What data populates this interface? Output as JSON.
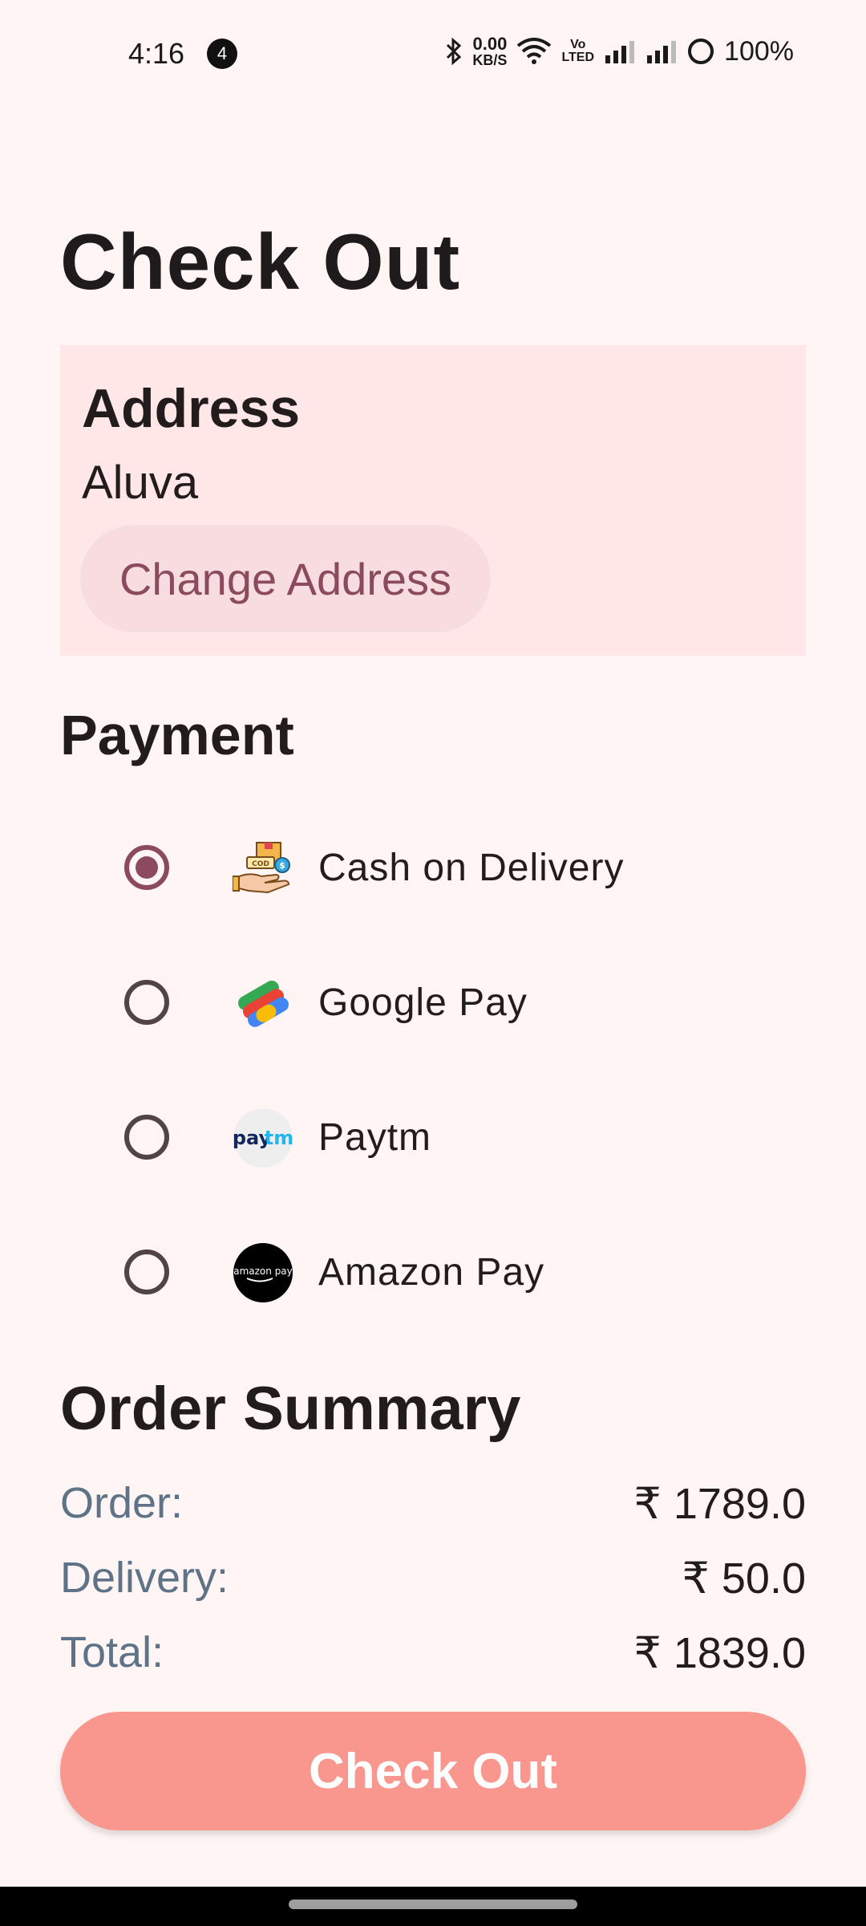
{
  "status_bar": {
    "time": "4:16",
    "notification_count": "4",
    "network_speed_value": "0.00",
    "network_speed_unit": "KB/S",
    "volte_top": "Vo",
    "volte_bottom": "LTED",
    "battery": "100%"
  },
  "page": {
    "title": "Check Out"
  },
  "address": {
    "heading": "Address",
    "value": "Aluva",
    "change_label": "Change Address"
  },
  "payment": {
    "heading": "Payment",
    "selected": "Cash on Delivery",
    "options": [
      {
        "label": "Cash on Delivery",
        "icon": "cash-on-delivery-icon",
        "selected": true
      },
      {
        "label": "Google Pay",
        "icon": "google-pay-icon",
        "selected": false
      },
      {
        "label": "Paytm",
        "icon": "paytm-icon",
        "selected": false
      },
      {
        "label": "Amazon Pay",
        "icon": "amazon-pay-icon",
        "selected": false
      }
    ]
  },
  "summary": {
    "heading": "Order Summary",
    "rows": [
      {
        "label": "Order:",
        "value": "₹ 1789.0"
      },
      {
        "label": "Delivery:",
        "value": "₹ 50.0"
      },
      {
        "label": "Total:",
        "value": "₹ 1839.0"
      }
    ]
  },
  "checkout_button": {
    "label": "Check Out"
  },
  "colors": {
    "background": "#fff5f4",
    "address_card": "#ffe7e8",
    "accent": "#8b4a5e",
    "checkout_button": "#f9968e",
    "summary_label": "#5e7387"
  }
}
